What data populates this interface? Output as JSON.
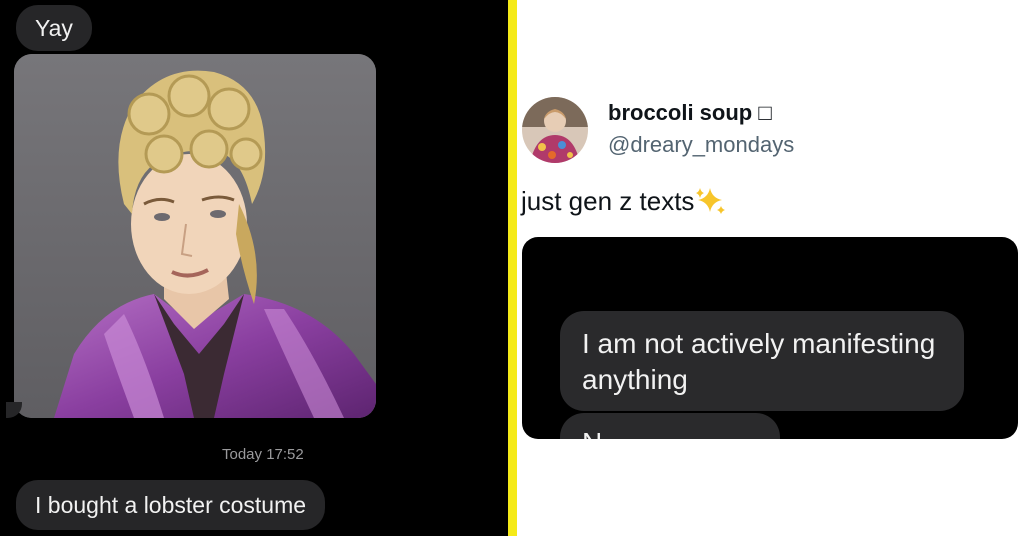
{
  "left_chat": {
    "message_1": "Yay",
    "timestamp": "Today 17:52",
    "message_2": "I bought a lobster costume"
  },
  "tweet": {
    "display_name": "broccoli soup",
    "name_emoji": "□",
    "handle": "@dreary_mondays",
    "text": "just gen z texts",
    "sparkle_emoji": "sparkles-icon"
  },
  "embedded_chat": {
    "message_1": "I am not actively manifesting anything",
    "message_2_partial": "N"
  },
  "colors": {
    "divider": "#f5ea18",
    "bubble": "#262628",
    "handle": "#536471"
  }
}
